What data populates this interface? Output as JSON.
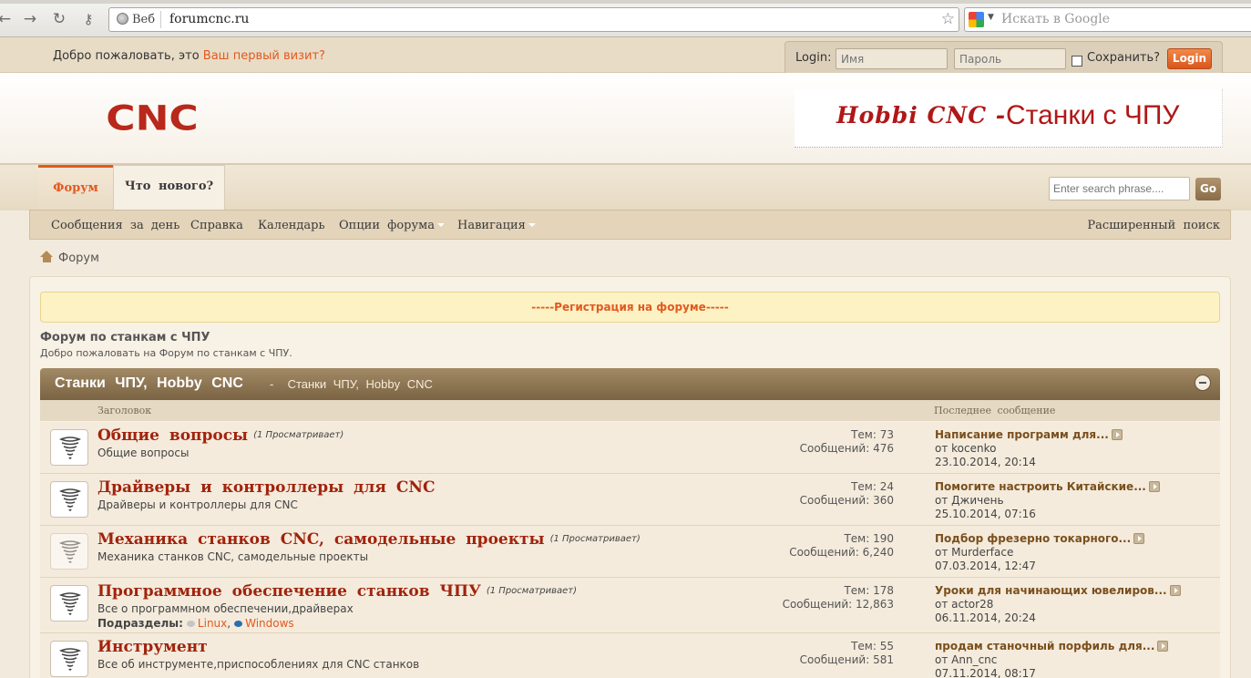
{
  "browser": {
    "identity_label": "Веб",
    "url": "forumcnc.ru",
    "search_placeholder": "Искать в Google"
  },
  "topbar": {
    "welcome_text": "Добро пожаловать, это",
    "first_visit_link": "Ваш первый визит?",
    "login_label": "Login:",
    "username_placeholder": "Имя",
    "password_placeholder": "Пароль",
    "remember_label": "Сохранить?",
    "login_button": "Login"
  },
  "header": {
    "logo_text": "CNC",
    "banner_italic": "Hobbi CNC -",
    "banner_text": "Станки с ЧПУ"
  },
  "tabs": [
    {
      "label": "Форум"
    },
    {
      "label": "Что нового?"
    }
  ],
  "search": {
    "placeholder": "Enter search phrase....",
    "go_label": "Go"
  },
  "navbar": {
    "items": [
      "Сообщения за день",
      "Справка",
      "Календарь",
      "Опции форума",
      "Навигация"
    ],
    "advanced_search": "Расширенный поиск"
  },
  "breadcrumb": {
    "label": "Форум"
  },
  "notice": "-----Регистрация на форуме-----",
  "forum": {
    "title": "Форум по станкам с ЧПУ",
    "description": "Добро пожаловать на Форум по станкам с ЧПУ."
  },
  "category": {
    "title": "Станки ЧПУ, Hobby CNC",
    "separator": "-",
    "description": "Станки ЧПУ, Hobby CNC",
    "col_title": "Заголовок",
    "col_last": "Последнее сообщение"
  },
  "forums": [
    {
      "name": "Общие вопросы",
      "viewing": "(1 Просматривает)",
      "desc": "Общие вопросы",
      "topics": "Тем: 73",
      "posts": "Сообщений: 476",
      "last_title": "Написание программ для...",
      "last_by": "от kocenko",
      "last_date": "23.10.2014, 20:14"
    },
    {
      "name": "Драйверы и контроллеры для CNC",
      "viewing": "",
      "desc": "Драйверы и контроллеры для CNC",
      "topics": "Тем: 24",
      "posts": "Сообщений: 360",
      "last_title": "Помогите настроить Китайские...",
      "last_by": "от Джичень",
      "last_date": "25.10.2014, 07:16"
    },
    {
      "name": "Механика станков CNC, самодельные проекты",
      "viewing": "(1 Просматривает)",
      "desc": "Механика станков CNC, самодельные проекты",
      "topics": "Тем: 190",
      "posts": "Сообщений: 6,240",
      "last_title": "Подбор фрезерно токарного...",
      "last_by": "от Murderface",
      "last_date": "07.03.2014, 12:47"
    },
    {
      "name": "Программное обеспечение станков ЧПУ",
      "viewing": "(1 Просматривает)",
      "desc": "Все о программном обеспечении,драйверах",
      "sub_label": "Подразделы:",
      "sub1": "Linux",
      "sub_sep": ",",
      "sub2": "Windows",
      "topics": "Тем: 178",
      "posts": "Сообщений: 12,863",
      "last_title": "Уроки для начинающих ювелиров...",
      "last_by": "от actor28",
      "last_date": "06.11.2014, 20:24"
    },
    {
      "name": "Инструмент",
      "viewing": "",
      "desc": "Все об инструменте,приспособлениях для CNC станков",
      "topics": "Тем: 55",
      "posts": "Сообщений: 581",
      "last_title": "продам станочный порфиль для...",
      "last_by": "от Ann_cnc",
      "last_date": "07.11.2014, 08:17"
    }
  ]
}
